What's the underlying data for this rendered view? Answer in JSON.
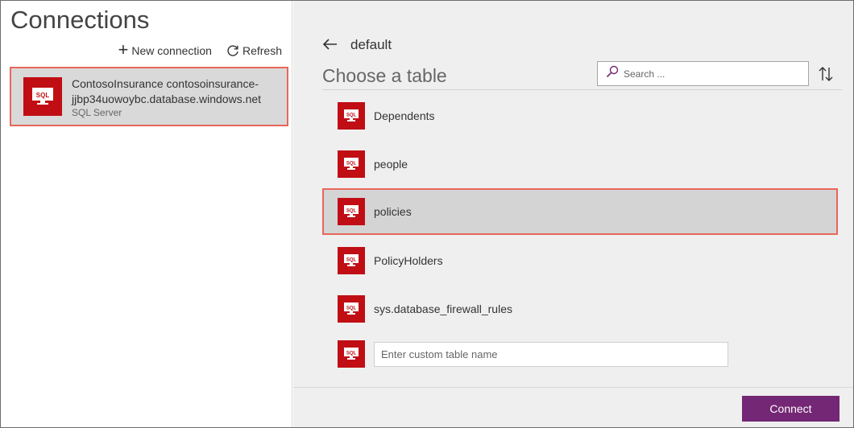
{
  "left": {
    "title": "Connections",
    "new_connection_label": "New connection",
    "refresh_label": "Refresh",
    "connection": {
      "name": "ContosoInsurance contosoinsurance-jjbp34uowoybc.database.windows.net",
      "name_line1": "ContosoInsurance contosoinsurance-",
      "name_line2": "jjbp34uowoybc.database.windows.net",
      "type": "SQL Server",
      "icon": "sql-server-icon"
    }
  },
  "right": {
    "database": "default",
    "heading": "Choose a table",
    "search_placeholder": "Search ...",
    "tables": [
      {
        "name": "Dependents",
        "selected": false
      },
      {
        "name": "people",
        "selected": false
      },
      {
        "name": "policies",
        "selected": true
      },
      {
        "name": "PolicyHolders",
        "selected": false
      },
      {
        "name": "sys.database_firewall_rules",
        "selected": false
      }
    ],
    "custom_table_placeholder": "Enter custom table name",
    "connect_label": "Connect"
  },
  "colors": {
    "sql_red": "#c00e14",
    "highlight_border": "#e8675b",
    "connect_purple": "#742774"
  }
}
